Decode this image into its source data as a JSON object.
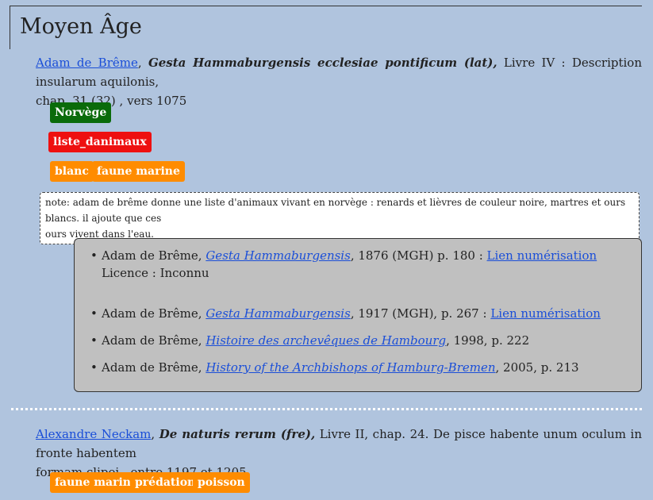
{
  "section": {
    "title": "Moyen Âge"
  },
  "entries": [
    {
      "author": "Adam de Brême",
      "sep": ", ",
      "work": "Gesta Hammaburgensis ecclesiae pontificum (lat),",
      "detail_line1": " Livre IV : Description insularum aquilonis,",
      "detail_line2": "chap. 31 (32) , vers 1075",
      "tags_row1": [
        "Norvège"
      ],
      "tags_row2": [
        "liste_danimaux"
      ],
      "tags_row3": [
        "blanc",
        "faune marine"
      ],
      "note_line1": "note: adam de brême donne une liste d'animaux vivant en norvège : renards et lièvres de couleur noire, martres et ours blancs. il ajoute que ces",
      "note_line2": "ours vivent dans l'eau.",
      "references": [
        {
          "author": "Adam de Brême, ",
          "title": "Gesta Hammaburgensis",
          "rest": ", 1876 (MGH) p. 180 : ",
          "link": "Lien numérisation",
          "licence": "Licence : Inconnu"
        },
        {
          "author": "Adam de Brême, ",
          "title": "Gesta Hammaburgensis",
          "rest": ", 1917 (MGH), p. 267 : ",
          "link": "Lien numérisation"
        },
        {
          "author": "Adam de Brême, ",
          "title": "Histoire des archevêques de Hambourg",
          "rest": ", 1998, p. 222"
        },
        {
          "author": "Adam de Brême, ",
          "title": "History of the Archbishops of Hamburg-Bremen",
          "rest": ", 2005, p. 213"
        }
      ]
    },
    {
      "author": "Alexandre Neckam",
      "sep": ", ",
      "work": "De naturis rerum (fre),",
      "detail_line1": " Livre II, chap. 24. De pisce habente unum oculum in fronte habentem",
      "detail_line2": "formam clipei , entre 1197 et 1205",
      "tags_row1": [
        "faune marine",
        "prédation",
        "poisson"
      ]
    }
  ],
  "colors": {
    "background": "#b0c4de",
    "tag_green": "#0a6b0a",
    "tag_red": "#ee1010",
    "tag_orange": "#ff8c00",
    "link": "#1a4ed8"
  }
}
